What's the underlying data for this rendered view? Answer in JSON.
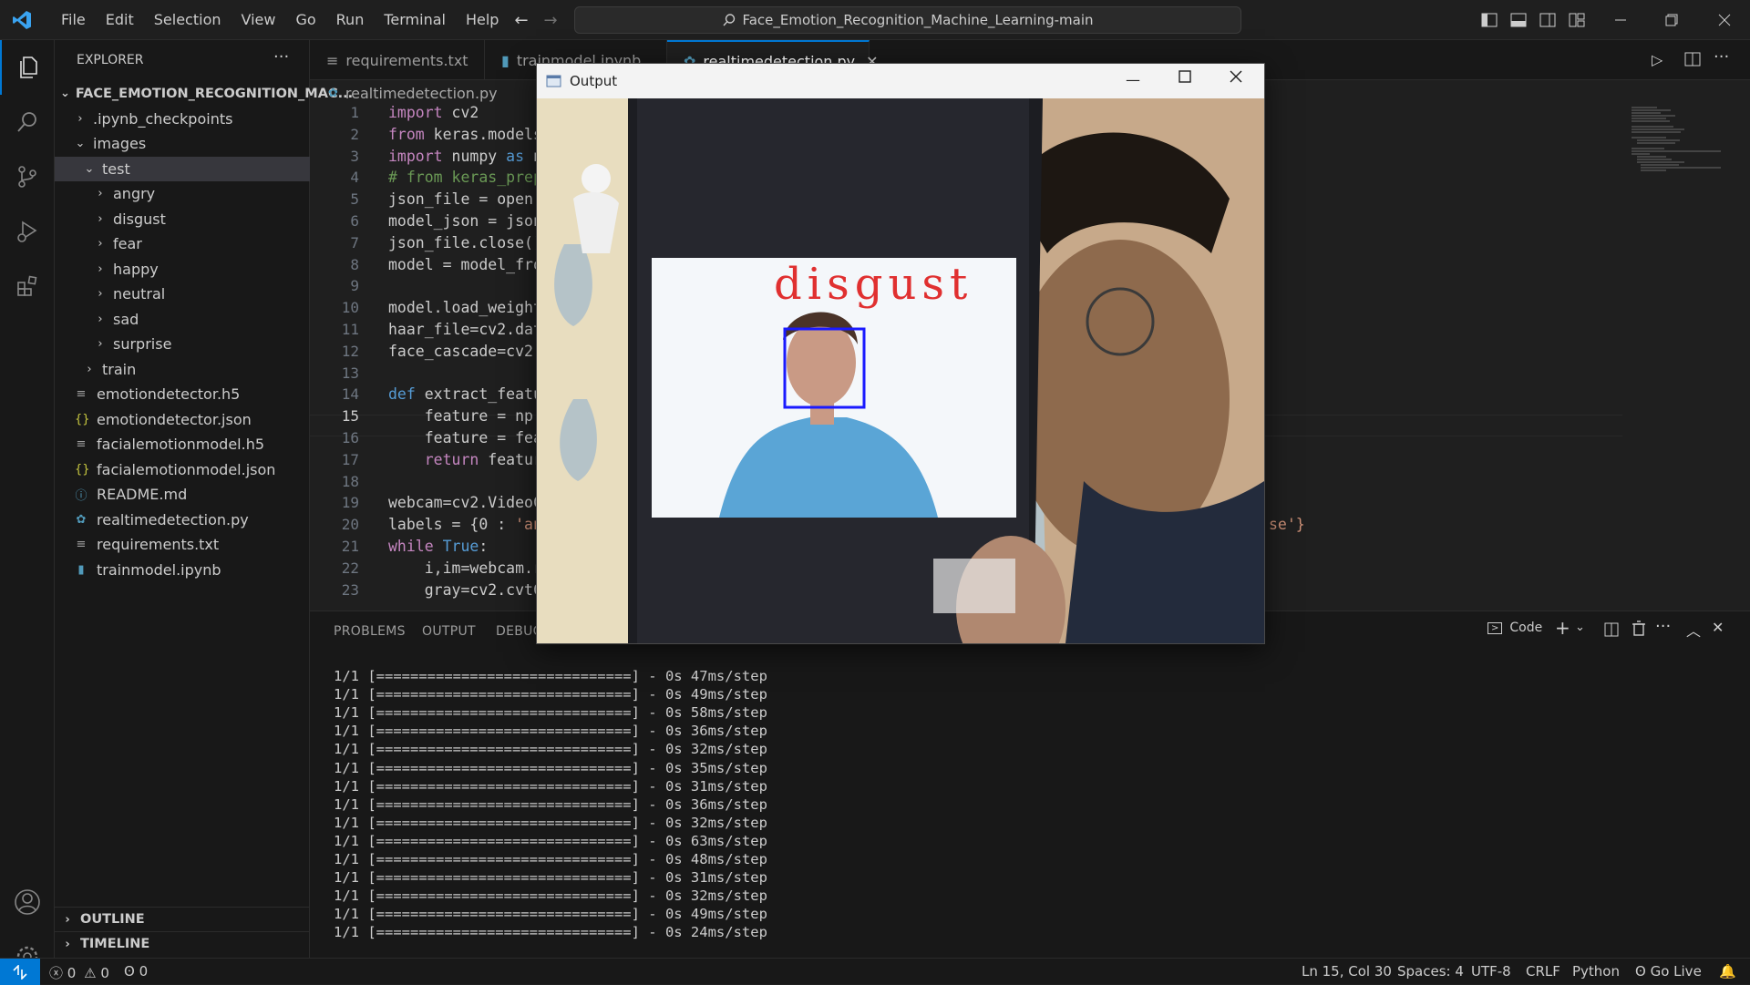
{
  "titlebar": {
    "menu": [
      "File",
      "Edit",
      "Selection",
      "View",
      "Go",
      "Run",
      "Terminal",
      "Help"
    ],
    "search": "Face_Emotion_Recognition_Machine_Learning-main"
  },
  "sidebar": {
    "header": "EXPLORER",
    "root": "FACE_EMOTION_RECOGNITION_MAC...",
    "items": [
      {
        "label": ".ipynb_checkpoints"
      },
      {
        "label": "images"
      },
      {
        "label": "test"
      },
      {
        "label": "angry"
      },
      {
        "label": "disgust"
      },
      {
        "label": "fear"
      },
      {
        "label": "happy"
      },
      {
        "label": "neutral"
      },
      {
        "label": "sad"
      },
      {
        "label": "surprise"
      },
      {
        "label": "train"
      },
      {
        "label": "emotiondetector.h5"
      },
      {
        "label": "emotiondetector.json"
      },
      {
        "label": "facialemotionmodel.h5"
      },
      {
        "label": "facialemotionmodel.json"
      },
      {
        "label": "README.md"
      },
      {
        "label": "realtimedetection.py"
      },
      {
        "label": "requirements.txt"
      },
      {
        "label": "trainmodel.ipynb"
      }
    ],
    "outline": "OUTLINE",
    "timeline": "TIMELINE"
  },
  "tabs": [
    "requirements.txt",
    "trainmodel.ipynb",
    "realtimedetection.py"
  ],
  "breadcrumb": "realtimedetection.py",
  "editor": {
    "lines": [
      {
        "n": "1",
        "t": "import cv2"
      },
      {
        "n": "2",
        "t": "from keras.models"
      },
      {
        "n": "3",
        "t": "import numpy as n"
      },
      {
        "n": "4",
        "t": "# from keras_prep"
      },
      {
        "n": "5",
        "t": "json_file = open("
      },
      {
        "n": "6",
        "t": "model_json = json"
      },
      {
        "n": "7",
        "t": "json_file.close()"
      },
      {
        "n": "8",
        "t": "model = model_fro"
      },
      {
        "n": "9",
        "t": ""
      },
      {
        "n": "10",
        "t": "model.load_weight"
      },
      {
        "n": "11",
        "t": "haar_file=cv2.dat"
      },
      {
        "n": "12",
        "t": "face_cascade=cv2."
      },
      {
        "n": "13",
        "t": ""
      },
      {
        "n": "14",
        "t": "def extract_featu"
      },
      {
        "n": "15",
        "t": "    feature = np."
      },
      {
        "n": "16",
        "t": "    feature = fea"
      },
      {
        "n": "17",
        "t": "    return featur"
      },
      {
        "n": "18",
        "t": ""
      },
      {
        "n": "19",
        "t": "webcam=cv2.VideoC"
      },
      {
        "n": "20",
        "t": "labels = {0 : 'an"
      },
      {
        "n": "21",
        "t": "while True:"
      },
      {
        "n": "22",
        "t": "    i,im=webcam.r"
      },
      {
        "n": "23",
        "t": "    gray=cv2.cvtC"
      }
    ],
    "line20_tail": "se'}"
  },
  "panel": {
    "tabs": [
      "PROBLEMS",
      "OUTPUT",
      "DEBUG"
    ],
    "terminal_label": "Code",
    "terminal_lines": [
      "1/1 [==============================] - 0s 47ms/step",
      "1/1 [==============================] - 0s 49ms/step",
      "1/1 [==============================] - 0s 58ms/step",
      "1/1 [==============================] - 0s 36ms/step",
      "1/1 [==============================] - 0s 32ms/step",
      "1/1 [==============================] - 0s 35ms/step",
      "1/1 [==============================] - 0s 31ms/step",
      "1/1 [==============================] - 0s 36ms/step",
      "1/1 [==============================] - 0s 32ms/step",
      "1/1 [==============================] - 0s 63ms/step",
      "1/1 [==============================] - 0s 48ms/step",
      "1/1 [==============================] - 0s 31ms/step",
      "1/1 [==============================] - 0s 32ms/step",
      "1/1 [==============================] - 0s 49ms/step",
      "1/1 [==============================] - 0s 24ms/step"
    ]
  },
  "output_window": {
    "title": "Output",
    "detected_label": "disgust"
  },
  "statusbar": {
    "errors": "0",
    "warnings": "0",
    "ports": "0",
    "position": "Ln 15, Col 30",
    "spaces": "Spaces: 4",
    "encoding": "UTF-8",
    "eol": "CRLF",
    "language": "Python",
    "golive": "Go Live"
  },
  "colors": {
    "accent": "#0078d4",
    "keyword": "#c586c0",
    "keyword_blue": "#569cd6",
    "function": "#dcdcaa",
    "comment": "#6a9955",
    "detection_box": "#1a1aff",
    "detection_text": "#e03030"
  }
}
